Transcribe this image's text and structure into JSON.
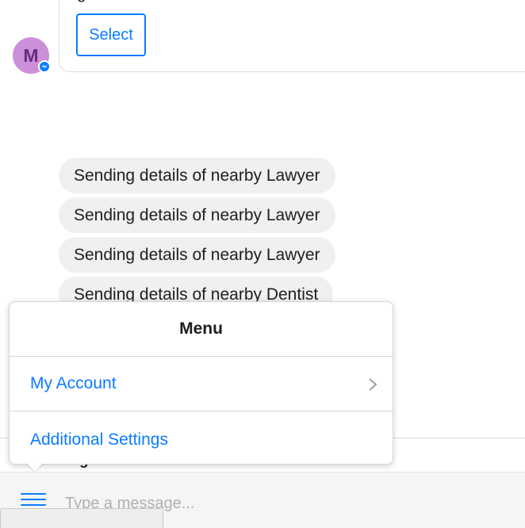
{
  "conversation": {
    "top_card": {
      "clipped_text": "g",
      "select_label": "Select"
    },
    "avatar_letter": "M",
    "messages": [
      "Sending details of nearby Lawyer",
      "Sending details of nearby Lawyer",
      "Sending details of nearby Lawyer",
      "Sending details of nearby Dentist"
    ]
  },
  "menu": {
    "title": "Menu",
    "items": [
      {
        "label": "My Account",
        "has_submenu": true,
        "icon": "chevron-right-icon"
      },
      {
        "label": "Additional Settings",
        "has_submenu": false
      }
    ]
  },
  "composer": {
    "peek_text": "g",
    "placeholder": "Type a message...",
    "menu_icon": "hamburger-icon"
  },
  "colors": {
    "accent": "#0a7cff",
    "bubble": "#f0f0f0",
    "avatar_bg": "#cc8fd9",
    "avatar_text": "#6a2a83"
  }
}
